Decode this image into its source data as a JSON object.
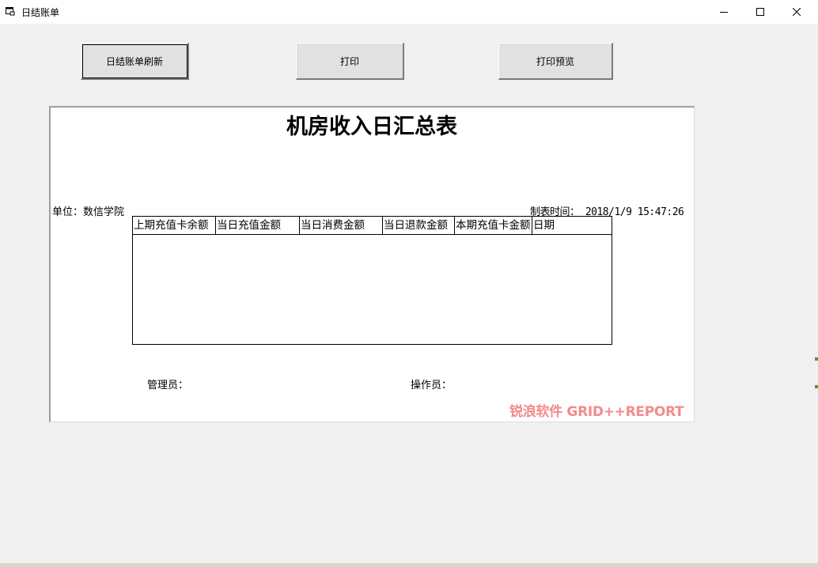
{
  "window": {
    "title": "日结账单",
    "app_icon": "window-app-icon",
    "controls": {
      "minimize": "minimize-icon",
      "maximize": "maximize-icon",
      "close": "close-icon"
    }
  },
  "toolbar": {
    "refresh_label": "日结账单刷新",
    "print_label": "打印",
    "preview_label": "打印预览"
  },
  "report": {
    "title": "机房收入日汇总表",
    "unit": "单位：数信学院",
    "made_time": "制表时间： 2018/1/9 15:47:26",
    "columns": [
      "上期充值卡余额",
      "当日充值金额",
      "当日消费金额",
      "当日退款金额",
      "本期充值卡金额",
      "日期"
    ],
    "rows": [],
    "admin_label": "管理员：",
    "operator_label": "操作员：",
    "watermark": "锐浪软件 GRID++REPORT"
  },
  "colors": {
    "background": "#f0f0f0",
    "report_bg": "#ffffff",
    "watermark": "#f28b8b"
  }
}
